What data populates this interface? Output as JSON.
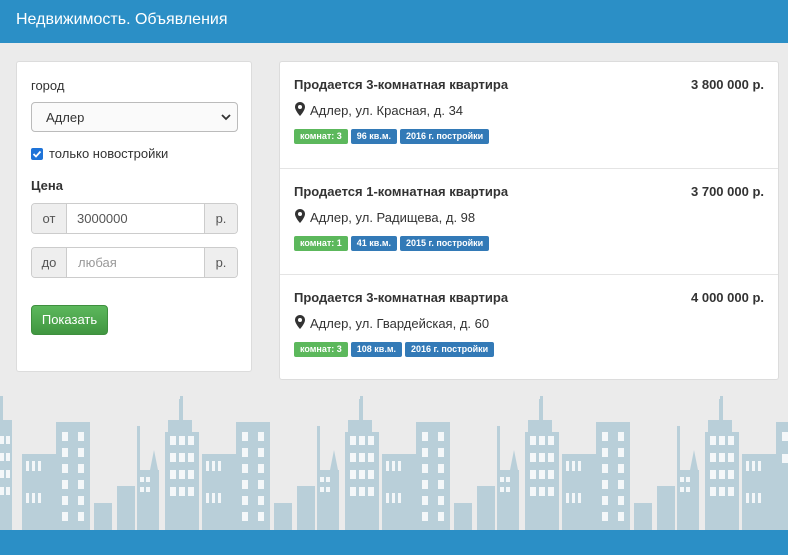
{
  "header": {
    "title": "Недвижимость. Объявления"
  },
  "filter": {
    "city_label": "город",
    "city_value": "Адлер",
    "new_only_label": "только новостройки",
    "new_only_checked": true,
    "price_label": "Цена",
    "from": {
      "prefix": "от",
      "value": "3000000",
      "suffix": "р."
    },
    "to": {
      "prefix": "до",
      "placeholder": "любая",
      "suffix": "р."
    },
    "submit_label": "Показать"
  },
  "listings": [
    {
      "title": "Продается 3-комнатная квартира",
      "price": "3 800 000 р.",
      "address": "Адлер, ул. Красная, д. 34",
      "badges": [
        "комнат: 3",
        "96 кв.м.",
        "2016 г. постройки"
      ]
    },
    {
      "title": "Продается 1-комнатная квартира",
      "price": "3 700 000 р.",
      "address": "Адлер, ул. Радищева, д. 98",
      "badges": [
        "комнат: 1",
        "41 кв.м.",
        "2015 г. постройки"
      ]
    },
    {
      "title": "Продается 3-комнатная квартира",
      "price": "4 000 000 р.",
      "address": "Адлер, ул. Гвардейская, д. 60",
      "badges": [
        "комнат: 3",
        "108 кв.м.",
        "2016 г. постройки"
      ]
    }
  ],
  "colors": {
    "brand": "#2b8fc6",
    "success": "#5cb85c",
    "primary": "#337ab7",
    "skyline": "#b9cfd9"
  }
}
